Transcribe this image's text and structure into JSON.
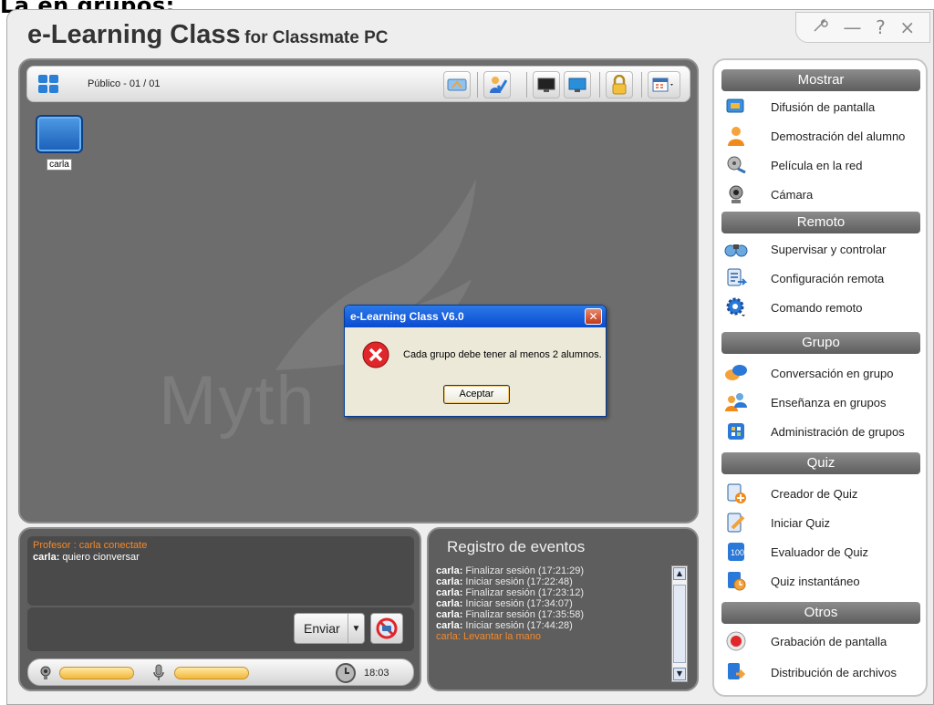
{
  "page_heading": "La en grupos:",
  "app": {
    "title_main": "e-Learning Class",
    "title_sub": "for Classmate PC"
  },
  "window_controls": {
    "tools": "tools-icon",
    "minimize": "—",
    "help": "?",
    "close": "×"
  },
  "toolbar": {
    "view_label": "Público - 01 / 01",
    "buttons": [
      "broadcast-icon",
      "check-icon",
      "monitor-black-icon",
      "monitor-blue-icon",
      "lock-icon",
      "layout-menu-icon"
    ]
  },
  "students": [
    {
      "name": "carla"
    }
  ],
  "watermark": "Myth",
  "chat": {
    "messages": [
      {
        "sender": "Profesor",
        "separator": " : ",
        "text": "carla conectate",
        "color": "#f5892b"
      },
      {
        "sender": "carla:",
        "separator": " ",
        "text": "quiero cionversar",
        "color": "#ffffff"
      }
    ],
    "send_label": "Enviar",
    "clock": "18:03"
  },
  "events": {
    "title": "Registro de eventos",
    "items": [
      {
        "user": "carla:",
        "text": "Finalizar sesión (17:21:29)"
      },
      {
        "user": "carla:",
        "text": "Iniciar sesión (17:22:48)"
      },
      {
        "user": "carla:",
        "text": "Finalizar sesión (17:23:12)"
      },
      {
        "user": "carla:",
        "text": "Iniciar sesión (17:34:07)"
      },
      {
        "user": "carla:",
        "text": "Finalizar sesión (17:35:58)"
      },
      {
        "user": "carla:",
        "text": "Iniciar sesión (17:44:28)"
      },
      {
        "user": "carla:",
        "text": "Levantar la mano",
        "highlight": true
      }
    ]
  },
  "sidebar": {
    "mostrar": {
      "title": "Mostrar",
      "items": [
        "Difusión de pantalla",
        "Demostración del alumno",
        "Película en la red",
        "Cámara"
      ]
    },
    "remoto": {
      "title": "Remoto",
      "items": [
        "Supervisar y controlar",
        "Configuración remota",
        "Comando remoto"
      ]
    },
    "grupo": {
      "title": "Grupo",
      "items": [
        "Conversación en grupo",
        "Enseñanza en grupos",
        "Administración de grupos"
      ]
    },
    "quiz": {
      "title": "Quiz",
      "items": [
        "Creador de Quiz",
        "Iniciar Quiz",
        "Evaluador de Quiz",
        "Quiz instantáneo"
      ]
    },
    "otros": {
      "title": "Otros",
      "items": [
        "Grabación de pantalla",
        "Distribución de archivos"
      ]
    }
  },
  "dialog": {
    "title": "e-Learning Class V6.0",
    "message": "Cada grupo debe tener al menos 2 alumnos.",
    "ok_label": "Aceptar",
    "icon": "error-icon"
  }
}
